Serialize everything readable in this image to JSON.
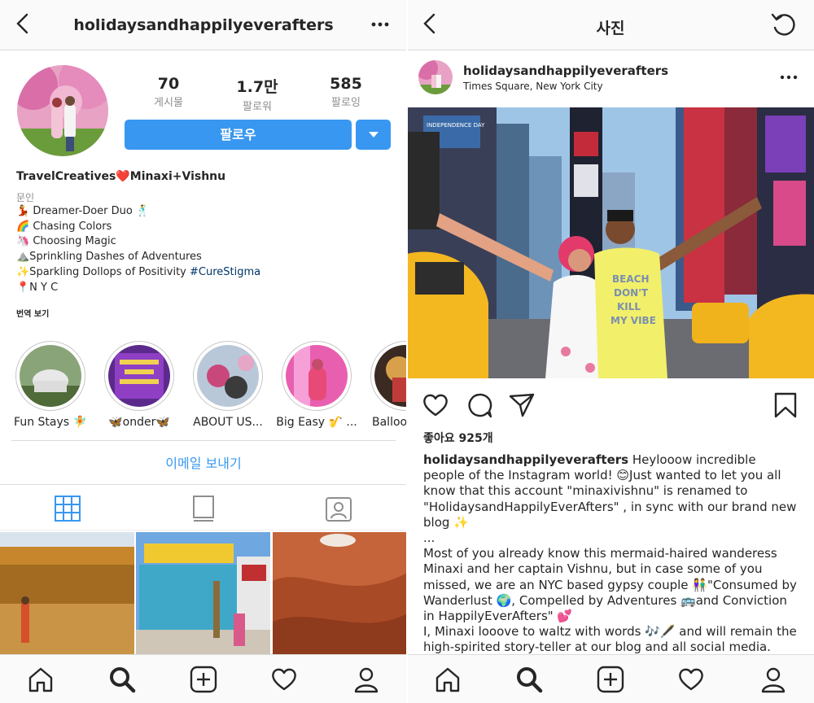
{
  "profile_screen": {
    "header": {
      "username": "holidaysandhappilyeverafters"
    },
    "stats": [
      {
        "value": "70",
        "label": "게시물"
      },
      {
        "value": "1.7만",
        "label": "팔로워"
      },
      {
        "value": "585",
        "label": "팔로잉"
      }
    ],
    "follow_label": "팔로우",
    "bio": {
      "name": "TravelCreatives❤️Minaxi+Vishnu",
      "category": "문인",
      "lines": [
        "💃 Dreamer-Doer Duo 🕺",
        "🌈 Chasing Colors",
        "🦄 Choosing Magic",
        "⛰️Sprinkling Dashes of Adventures",
        "✨Sparkling Dollops of Positivity "
      ],
      "hashtag": "#CureStigma",
      "location_line": "📍N Y C",
      "translate": "번역 보기"
    },
    "highlights": [
      {
        "label": "Fun Stays 🧚"
      },
      {
        "label": "🦋onder🦋"
      },
      {
        "label": "ABOUT US..."
      },
      {
        "label": "Big Easy 🎷 ..."
      },
      {
        "label": "Balloon"
      }
    ],
    "email_label": "이메일 보내기"
  },
  "post_screen": {
    "header": {
      "title": "사진"
    },
    "username": "holidaysandhappilyeverafters",
    "location": "Times Square, New York City",
    "likes": "좋아요 925개",
    "caption": {
      "username": "holidaysandhappilyeverafters",
      "para1": " Heylooow incredible people of the Instagram world! 😊Just wanted to let you all know that this account \"minaxivishnu\" is renamed to \"HolidaysandHappilyEverAfters\" , in sync with our brand new blog ✨",
      "ellipsis": "...",
      "para2": "Most of you already know this mermaid-haired wanderess Minaxi and her captain Vishnu, but in case some of you missed, we are an NYC based gypsy couple 👫\"Consumed by Wanderlust 🌍, Compelled by Adventures 🚌and Conviction in HappilyEverAfters\" 💕",
      "para3": "I, Minaxi looove to waltz with words 🎶🖋️ and will remain the high-spirited story-teller at our blog and all social media."
    },
    "photo_signs": {
      "independence": "INDEPENDENCE DAY",
      "shirt": "BEACH DON'T KILL MY VIBE"
    }
  },
  "colors": {
    "accent": "#3897f0",
    "hashtag": "#003569",
    "muted": "#8e8e8e",
    "border": "#dbdbdb"
  }
}
